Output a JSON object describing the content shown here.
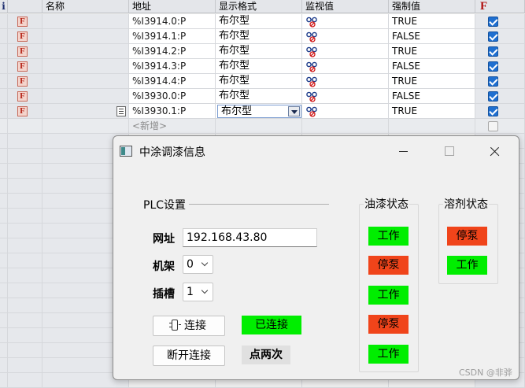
{
  "table": {
    "headers": [
      "i",
      "名称",
      "地址",
      "显示格式",
      "监视值",
      "强制值",
      "F"
    ],
    "rows": [
      {
        "address": "%I3914.0:P",
        "format": "布尔型",
        "force_value": "TRUE",
        "checked": true
      },
      {
        "address": "%I3914.1:P",
        "format": "布尔型",
        "force_value": "FALSE",
        "checked": true
      },
      {
        "address": "%I3914.2:P",
        "format": "布尔型",
        "force_value": "TRUE",
        "checked": true
      },
      {
        "address": "%I3914.3:P",
        "format": "布尔型",
        "force_value": "FALSE",
        "checked": true
      },
      {
        "address": "%I3914.4:P",
        "format": "布尔型",
        "force_value": "TRUE",
        "checked": true
      },
      {
        "address": "%I3930.0:P",
        "format": "布尔型",
        "force_value": "FALSE",
        "checked": true
      },
      {
        "address": "%I3930.1:P",
        "format": "布尔型",
        "force_value": "TRUE",
        "checked": true
      }
    ],
    "add_placeholder": "<新增>",
    "row_icon": "force-f-icon",
    "monitor_icon": "glasses-icon"
  },
  "dialog": {
    "title": "中涂调漆信息",
    "plc_section": "PLC设置",
    "address_label": "网址",
    "address_value": "192.168.43.80",
    "rack_label": "机架",
    "rack_value": "0",
    "slot_label": "插槽",
    "slot_value": "1",
    "connect_button": "连接",
    "connected_status": "已连接",
    "disconnect_button": "断开连接",
    "double_click_hint": "点两次",
    "oil_paint_title": "油漆状态",
    "oil_paint_states": [
      "工作",
      "停泵",
      "工作",
      "停泵",
      "工作"
    ],
    "solvent_title": "溶剂状态",
    "solvent_states": [
      "停泵",
      "工作"
    ]
  },
  "colors": {
    "working": "#00ee00",
    "stopped": "#f0441a",
    "connected": "#00ee00",
    "checkbox": "#1f6fd0",
    "force_icon": "#b42418"
  },
  "watermark": "CSDN @非骅"
}
